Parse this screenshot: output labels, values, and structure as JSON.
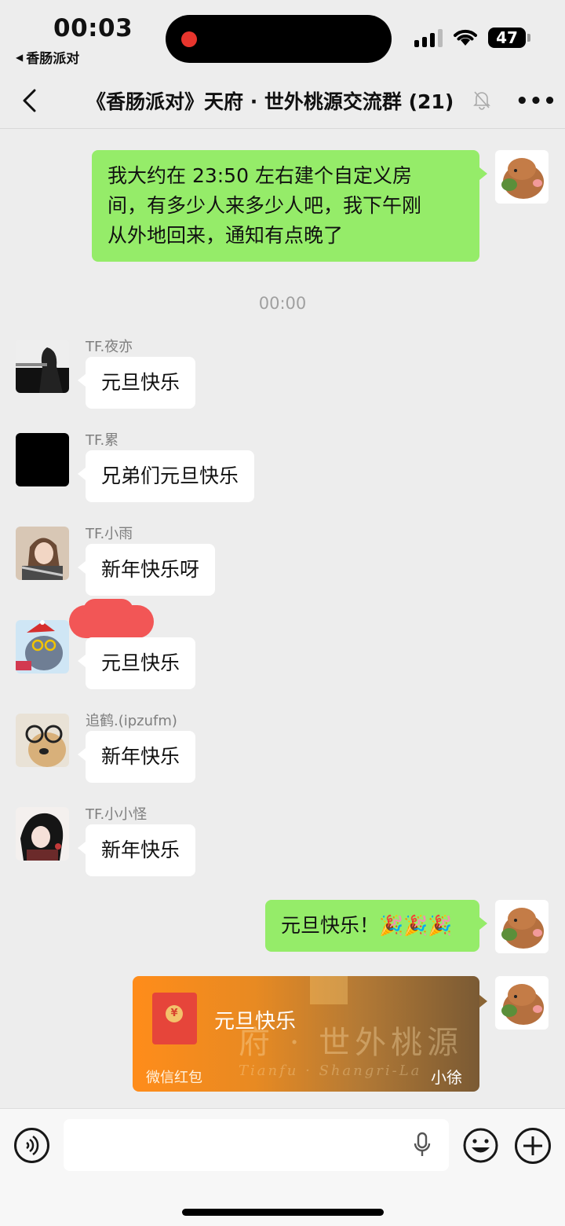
{
  "status_bar": {
    "time": "00:03",
    "back_app": "香肠派对",
    "battery": "47"
  },
  "nav": {
    "title": "《香肠派对》天府 · 世外桃源交流群 (21)",
    "icons": {
      "back": "chevron-left-icon",
      "mute": "bell-slash-icon",
      "more": "more-dots-icon"
    }
  },
  "chat": {
    "timestamp": "00:00",
    "messages": [
      {
        "from": "self",
        "text": "我大约在 23:50 左右建个自定义房\n间，有多少人来多少人吧，我下午刚\n从外地回来，通知有点晚了"
      },
      {
        "from": "TF.夜亦",
        "sender": "TF.夜亦",
        "text": "元旦快乐"
      },
      {
        "from": "TF.累",
        "sender": "TF.累",
        "text": "兄弟们元旦快乐"
      },
      {
        "from": "TF.小雨",
        "sender": "TF.小雨",
        "text": "新年快乐呀"
      },
      {
        "from": "redacted",
        "sender": "",
        "text": "元旦快乐"
      },
      {
        "from": "追鹤.(ipzufm)",
        "sender": "追鹤.(ipzufm)",
        "text": "新年快乐"
      },
      {
        "from": "TF.小小怪",
        "sender": "TF.小小怪",
        "text": "新年快乐"
      },
      {
        "from": "self",
        "text": "元旦快乐！🎉🎉🎉"
      }
    ],
    "red_packet": {
      "title": "元旦快乐",
      "label": "微信红包",
      "sender": "小徐",
      "decor_cn": "府 · 世外桃源",
      "decor_en": "Tianfu · Shangri-La",
      "seal": "¥"
    }
  },
  "input_bar": {
    "icons": {
      "voice": "voice-icon",
      "mic": "microphone-icon",
      "emoji": "emoji-icon",
      "plus": "plus-icon"
    }
  }
}
